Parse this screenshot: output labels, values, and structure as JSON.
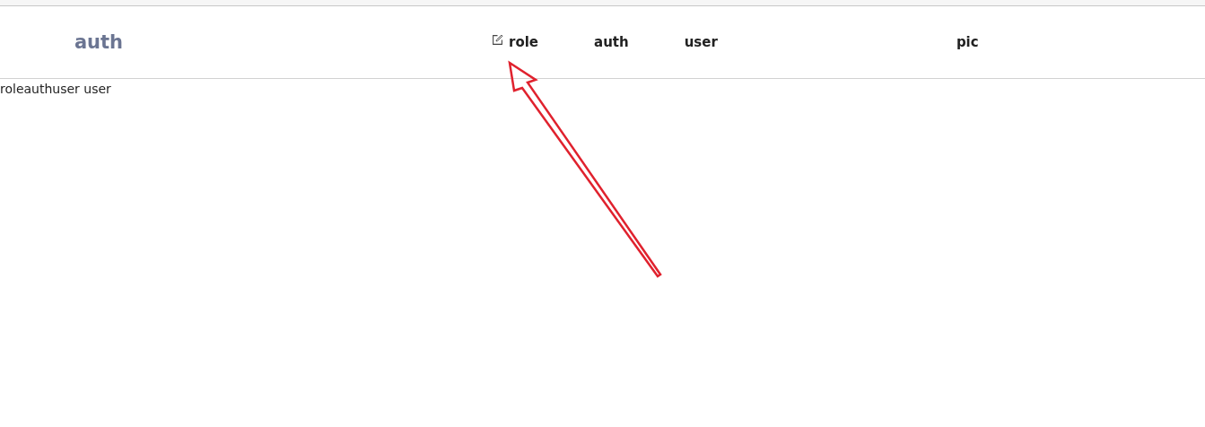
{
  "header": {
    "title": "auth",
    "menu": [
      {
        "label": "role",
        "kind": "icon-link"
      },
      {
        "label": "auth",
        "kind": "link"
      },
      {
        "label": "user",
        "kind": "link"
      },
      {
        "label": "pic",
        "kind": "far-link"
      }
    ]
  },
  "content": {
    "text": "roleauthuser user"
  },
  "annotation": {
    "kind": "arrow"
  }
}
